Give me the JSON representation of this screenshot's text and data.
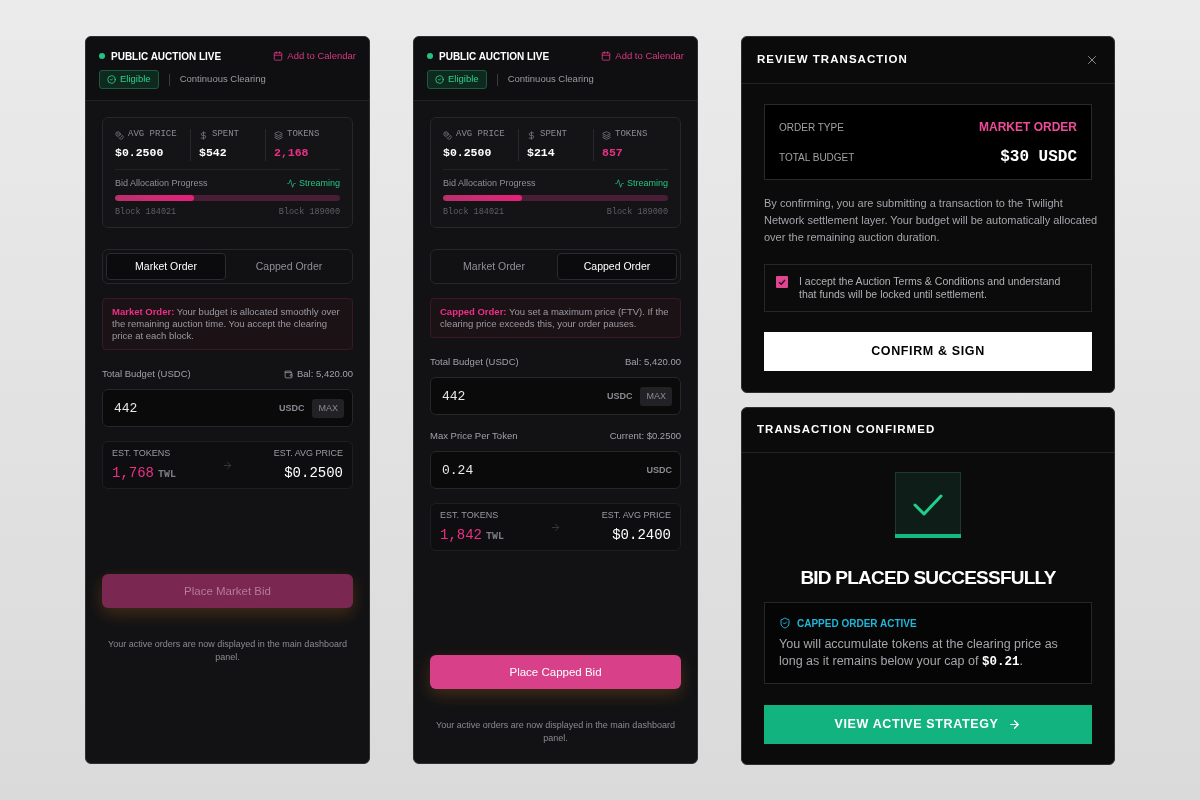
{
  "panels": [
    {
      "kind": "bid",
      "status": {
        "label": "PUBLIC AUCTION LIVE",
        "live": true
      },
      "calendar_link": "Add to Calendar",
      "eligibility": "Eligible",
      "mode": "Continuous Clearing",
      "stats": [
        {
          "kind": "price",
          "label": "AVG PRICE",
          "value": "$0.2500",
          "highlight": false
        },
        {
          "kind": "spent",
          "label": "SPENT",
          "value": "$542",
          "highlight": false
        },
        {
          "kind": "tokens",
          "label": "TOKENS",
          "value": "2,168",
          "highlight": true
        }
      ],
      "progress": {
        "label": "Bid Allocation Progress",
        "status": "Streaming",
        "level": 0.35,
        "start": "Block 184021",
        "end": "Block 189000"
      },
      "tabs": [
        {
          "label": "Market Order",
          "selected": true
        },
        {
          "label": "Capped Order",
          "selected": false
        }
      ],
      "note": {
        "lead": "Market Order:",
        "text": "Your budget is allocated smoothly over the remaining auction time. You accept the clearing price at each block."
      },
      "fields": [
        {
          "label": "Total Budget (USDC)",
          "hint": "Bal: 5,420.00",
          "wallet_icon": true,
          "value": "442",
          "unit": "USDC",
          "max_button": "MAX"
        }
      ],
      "estimate": {
        "tokens_label": "EST. TOKENS",
        "tokens": "1,768",
        "tokens_unit": "TWL",
        "price_label": "EST. AVG PRICE",
        "price": "$0.2500"
      },
      "submit": {
        "label": "Place Market Bid",
        "disabled": true
      },
      "footnote": "Your active orders are now displayed in the main dashboard panel."
    },
    {
      "kind": "bid",
      "status": {
        "label": "PUBLIC AUCTION LIVE",
        "live": true
      },
      "calendar_link": "Add to Calendar",
      "eligibility": "Eligible",
      "mode": "Continuous Clearing",
      "stats": [
        {
          "kind": "price",
          "label": "AVG PRICE",
          "value": "$0.2500",
          "highlight": false
        },
        {
          "kind": "spent",
          "label": "SPENT",
          "value": "$214",
          "highlight": false
        },
        {
          "kind": "tokens",
          "label": "TOKENS",
          "value": "857",
          "highlight": true
        }
      ],
      "progress": {
        "label": "Bid Allocation Progress",
        "status": "Streaming",
        "level": 0.35,
        "start": "Block 184021",
        "end": "Block 189000"
      },
      "tabs": [
        {
          "label": "Market Order",
          "selected": false
        },
        {
          "label": "Capped Order",
          "selected": true
        }
      ],
      "note": {
        "lead": "Capped Order:",
        "text": "You set a maximum price (FTV). If the clearing price exceeds this, your order pauses."
      },
      "fields": [
        {
          "label": "Total Budget (USDC)",
          "hint": "Bal: 5,420.00",
          "wallet_icon": false,
          "value": "442",
          "unit": "USDC",
          "max_button": "MAX"
        },
        {
          "label": "Max Price Per Token",
          "hint": "Current: $0.2500",
          "wallet_icon": false,
          "value": "0.24",
          "unit": "USDC"
        }
      ],
      "estimate": {
        "tokens_label": "EST. TOKENS",
        "tokens": "1,842",
        "tokens_unit": "TWL",
        "price_label": "EST. AVG PRICE",
        "price": "$0.2400"
      },
      "submit": {
        "label": "Place Capped Bid",
        "disabled": false
      },
      "footnote": "Your active orders are now displayed in the main dashboard panel."
    },
    {
      "kind": "review",
      "title": "REVIEW TRANSACTION",
      "summary": [
        {
          "kind": "order_type",
          "label": "ORDER TYPE",
          "value": "MARKET ORDER"
        },
        {
          "kind": "amount",
          "label": "TOTAL BUDGET",
          "value": "$30 USDC"
        }
      ],
      "description": "By confirming, you are submitting a transaction to the Twilight Network settlement layer. Your budget will be automatically allocated over the remaining auction duration.",
      "terms": {
        "text": "I accept the Auction Terms & Conditions and understand that funds will be locked until settlement.",
        "checked": true
      },
      "confirm_button": "CONFIRM & SIGN"
    },
    {
      "kind": "confirmed",
      "title": "TRANSACTION CONFIRMED",
      "headline": "BID PLACED SUCCESSFULLY",
      "notice": {
        "title": "CAPPED ORDER ACTIVE",
        "text": "You will accumulate tokens at the clearing price as long as it remains below your cap of **$0.21**."
      },
      "action_button": "VIEW ACTIVE STRATEGY"
    }
  ]
}
